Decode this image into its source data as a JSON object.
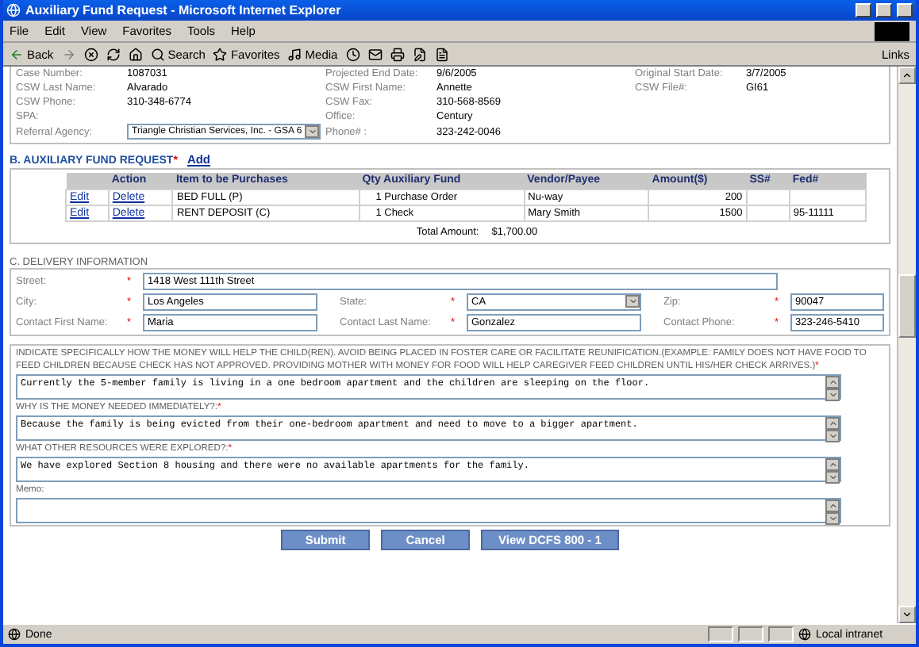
{
  "window": {
    "title": "Auxiliary Fund Request - Microsoft Internet Explorer"
  },
  "menu": [
    "File",
    "Edit",
    "View",
    "Favorites",
    "Tools",
    "Help"
  ],
  "toolbar": {
    "back": "Back",
    "search": "Search",
    "favorites": "Favorites",
    "media": "Media",
    "links": "Links"
  },
  "case_info": [
    [
      {
        "label": "Case Number:",
        "value": "1087031"
      },
      {
        "label": "Projected End Date:",
        "value": "9/6/2005"
      },
      {
        "label": "Original Start Date:",
        "value": "3/7/2005"
      }
    ],
    [
      {
        "label": "CSW Last Name:",
        "value": "Alvarado"
      },
      {
        "label": "CSW First Name:",
        "value": "Annette"
      },
      {
        "label": "CSW File#:",
        "value": "GI61"
      }
    ],
    [
      {
        "label": "CSW Phone:",
        "value": "310-348-6774"
      },
      {
        "label": "CSW Fax:",
        "value": "310-568-8569"
      }
    ],
    [
      {
        "label": "SPA:"
      },
      {
        "label": "Office:",
        "value": "Century"
      }
    ],
    [
      {
        "label": "Referral Agency:",
        "value": "Triangle Christian Services, Inc. - GSA 6",
        "kind": "select"
      },
      {
        "label": "Phone# :",
        "value": "323-242-0046"
      }
    ]
  ],
  "fund_request": {
    "title": "B. AUXILIARY FUND REQUEST",
    "marker": "*",
    "add": "Add",
    "columns": [
      "Action",
      "Item to be Purchases",
      "Qty Auxiliary Fund",
      "Vendor/Payee",
      "Amount($)",
      "SS#",
      "Fed#"
    ],
    "rows": [
      {
        "edit": "Edit",
        "delete": "Delete",
        "item": "BED FULL (P)",
        "qty": "1 Purchase Order",
        "vendor": "Nu-way",
        "amount": "200",
        "ss": "",
        "fed": ""
      },
      {
        "edit": "Edit",
        "delete": "Delete",
        "item": "RENT DEPOSIT (C)",
        "qty": "1 Check",
        "vendor": "Mary Smith",
        "amount": "1500",
        "ss": "",
        "fed": "95-11111"
      }
    ],
    "total_label": "Total Amount:",
    "total_value": "$1,700.00"
  },
  "delivery": {
    "title": "C. DELIVERY INFORMATION",
    "street": {
      "label": "Street:",
      "marker": "*",
      "value": "1418 West 111th Street"
    },
    "rows": [
      [
        {
          "label": "City:",
          "marker": "*",
          "value": "Los Angeles",
          "kind": "text"
        },
        {
          "label": "State:",
          "marker": "*",
          "value": "CA",
          "kind": "select"
        },
        {
          "label": "Zip:",
          "marker": "*",
          "value": "90047",
          "kind": "text"
        }
      ],
      [
        {
          "label": "Contact First Name:",
          "marker": "*",
          "value": "Maria",
          "kind": "text"
        },
        {
          "label": "Contact Last Name:",
          "marker": "*",
          "value": "Gonzalez",
          "kind": "text"
        },
        {
          "label": "Contact Phone:",
          "marker": "*",
          "value": "323-246-5410",
          "kind": "text"
        }
      ]
    ]
  },
  "questions": [
    {
      "label": "INDICATE SPECIFICALLY HOW THE MONEY WILL HELP THE CHILD(REN). AVOID BEING PLACED IN FOSTER CARE OR FACILITATE REUNIFICATION.(EXAMPLE: FAMILY DOES NOT HAVE FOOD TO FEED CHILDREN BECAUSE CHECK HAS NOT APPROVED. PROVIDING MOTHER WITH MONEY FOR FOOD WILL HELP CAREGIVER FEED CHILDREN UNTIL HIS/HER CHECK ARRIVES.)",
      "marker": "*",
      "value": "Currently the 5-member family is living in a one bedroom apartment and the children are sleeping on the floor."
    },
    {
      "label": "WHY IS THE MONEY NEEDED IMMEDIATELY?:",
      "marker": "*",
      "value": "Because the family is being evicted from their one-bedroom apartment and need to move to a bigger apartment."
    },
    {
      "label": "WHAT OTHER RESOURCES WERE EXPLORED?:",
      "marker": "*",
      "value": "We have explored Section 8 housing and there were no available apartments for the family."
    },
    {
      "label": "Memo:"
    }
  ],
  "buttons": [
    "Submit",
    "Cancel",
    "View DCFS 800 - 1"
  ],
  "status_bar": {
    "text": "Done",
    "zone": "Local intranet"
  }
}
